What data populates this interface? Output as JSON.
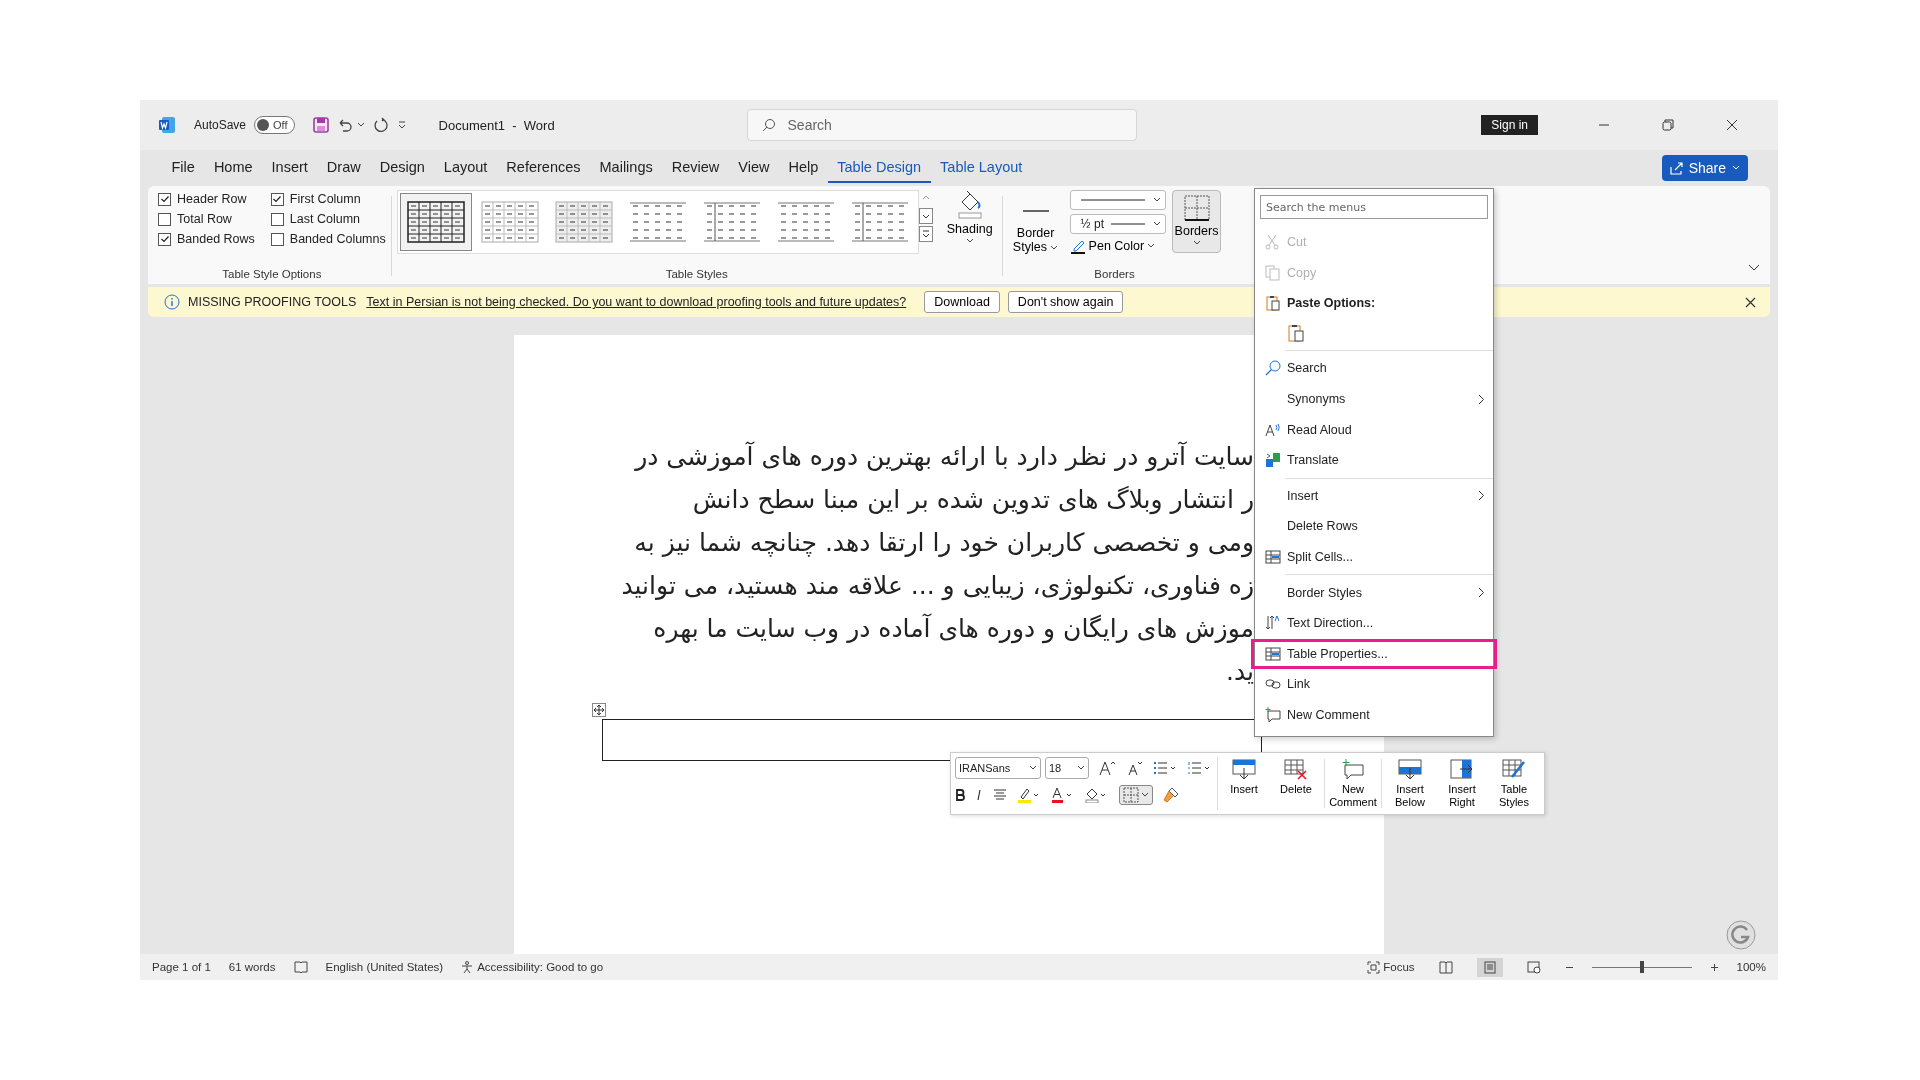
{
  "title_bar": {
    "autosave_label": "AutoSave",
    "autosave_on": false,
    "autosave_state": "Off",
    "document_title": "Document1  -  Word",
    "search_placeholder": "Search",
    "sign_in": "Sign in"
  },
  "menu_tabs": [
    {
      "label": "File",
      "selected": false,
      "kind": "normal"
    },
    {
      "label": "Home",
      "selected": false,
      "kind": "normal"
    },
    {
      "label": "Insert",
      "selected": false,
      "kind": "normal"
    },
    {
      "label": "Draw",
      "selected": false,
      "kind": "normal"
    },
    {
      "label": "Design",
      "selected": false,
      "kind": "normal"
    },
    {
      "label": "Layout",
      "selected": false,
      "kind": "normal"
    },
    {
      "label": "References",
      "selected": false,
      "kind": "normal"
    },
    {
      "label": "Mailings",
      "selected": false,
      "kind": "normal"
    },
    {
      "label": "Review",
      "selected": false,
      "kind": "normal"
    },
    {
      "label": "View",
      "selected": false,
      "kind": "normal"
    },
    {
      "label": "Help",
      "selected": false,
      "kind": "normal"
    },
    {
      "label": "Table Design",
      "selected": true,
      "kind": "contextual"
    },
    {
      "label": "Table Layout",
      "selected": false,
      "kind": "contextual"
    }
  ],
  "share": "Share",
  "ribbon": {
    "style_options": [
      {
        "label": "Header Row",
        "checked": true
      },
      {
        "label": "First Column",
        "checked": true
      },
      {
        "label": "Total Row",
        "checked": false
      },
      {
        "label": "Last Column",
        "checked": false
      },
      {
        "label": "Banded Rows",
        "checked": true
      },
      {
        "label": "Banded Columns",
        "checked": false
      }
    ],
    "style_options_group": "Table Style Options",
    "table_styles": [
      {
        "selected": true
      },
      {
        "selected": false
      },
      {
        "selected": false
      },
      {
        "selected": false
      },
      {
        "selected": false
      },
      {
        "selected": false
      },
      {
        "selected": false
      }
    ],
    "table_styles_group": "Table Styles",
    "shading": "Shading",
    "border_styles": "Border Styles",
    "pen_weight": "½ pt",
    "pen_color": "Pen Color",
    "borders": "Borders",
    "borders_group": "Borders"
  },
  "info_bar": {
    "title": "MISSING PROOFING TOOLS",
    "message": "Text in Persian is not being checked. Do you want to download proofing tools and future updates?",
    "buttons": [
      "Download",
      "Don't show again"
    ]
  },
  "document": {
    "lines": [
      "سایت آترو در نظر دارد با ارائه بهترین دوره های آموزشی در",
      "ر انتشار وبلاگ های تدوین شده بر این مبنا سطح  دانش",
      "ومی و تخصصی کاربران خود را ارتقا دهد. چنانچه شما نیز به",
      "زه فناوری، تکنولوژی، زیبایی و ... علاقه مند هستید، می توانید",
      "موزش های رایگان و دوره های آماده در وب سایت ما بهره",
      "ید."
    ]
  },
  "context_menu": {
    "search_placeholder": "Search the menus",
    "items": [
      {
        "kind": "command",
        "label": "Cut",
        "disabled": true,
        "submenu": false,
        "highlighted": false
      },
      {
        "kind": "command",
        "label": "Copy",
        "disabled": true,
        "submenu": false,
        "highlighted": false
      },
      {
        "kind": "header",
        "label": "Paste Options:"
      },
      {
        "kind": "paste"
      },
      {
        "kind": "divider"
      },
      {
        "kind": "command",
        "label": "Search",
        "disabled": false,
        "submenu": false,
        "highlighted": false
      },
      {
        "kind": "command",
        "label": "Synonyms",
        "disabled": false,
        "submenu": true,
        "highlighted": false
      },
      {
        "kind": "command",
        "label": "Read Aloud",
        "disabled": false,
        "submenu": false,
        "highlighted": false
      },
      {
        "kind": "command",
        "label": "Translate",
        "disabled": false,
        "submenu": false,
        "highlighted": false
      },
      {
        "kind": "divider"
      },
      {
        "kind": "command",
        "label": "Insert",
        "disabled": false,
        "submenu": true,
        "highlighted": false
      },
      {
        "kind": "command",
        "label": "Delete Rows",
        "disabled": false,
        "submenu": false,
        "highlighted": false
      },
      {
        "kind": "command",
        "label": "Split Cells...",
        "disabled": false,
        "submenu": false,
        "highlighted": false
      },
      {
        "kind": "divider"
      },
      {
        "kind": "command",
        "label": "Border Styles",
        "disabled": false,
        "submenu": true,
        "highlighted": false
      },
      {
        "kind": "command",
        "label": "Text Direction...",
        "disabled": false,
        "submenu": false,
        "highlighted": false
      },
      {
        "kind": "command",
        "label": "Table Properties...",
        "disabled": false,
        "submenu": false,
        "highlighted": true
      },
      {
        "kind": "command",
        "label": "Link",
        "disabled": false,
        "submenu": false,
        "highlighted": false
      },
      {
        "kind": "command",
        "label": "New Comment",
        "disabled": false,
        "submenu": false,
        "highlighted": false
      }
    ]
  },
  "mini_toolbar": {
    "font": "IRANSans",
    "size": "18",
    "buttons": [
      "Insert",
      "Delete",
      "New Comment",
      "Insert Below",
      "Insert Right",
      "Table Styles"
    ]
  },
  "status_bar": {
    "page": "Page 1 of 1",
    "words": "61 words",
    "language": "English (United States)",
    "accessibility": "Accessibility: Good to go",
    "focus": "Focus",
    "views": [
      {
        "selected": false
      },
      {
        "selected": true
      },
      {
        "selected": false
      }
    ],
    "zoom": {
      "level": 0.5
    },
    "zoom_label": "100%"
  }
}
